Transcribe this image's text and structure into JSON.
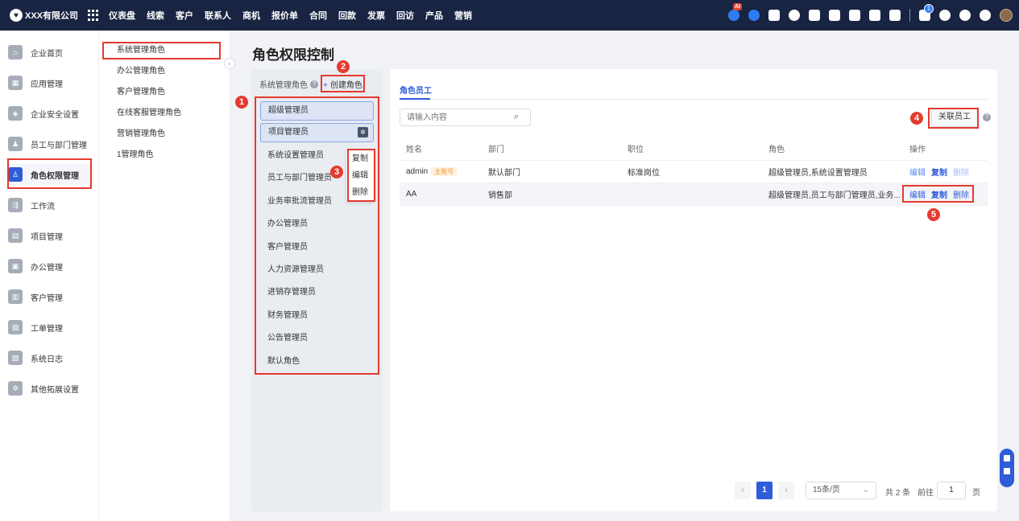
{
  "topbar": {
    "company": "XXX有限公司",
    "nav": [
      "仪表盘",
      "线索",
      "客户",
      "联系人",
      "商机",
      "报价单",
      "合同",
      "回款",
      "发票",
      "回访",
      "产品",
      "营销"
    ],
    "ai_badge": "AI",
    "notification_count": "1"
  },
  "sidebar": {
    "items": [
      "企业首页",
      "应用管理",
      "企业安全设置",
      "员工与部门管理",
      "角色权限管理",
      "工作流",
      "项目管理",
      "办公管理",
      "客户管理",
      "工单管理",
      "系统日志",
      "其他拓展设置"
    ]
  },
  "submenu": {
    "items": [
      "系统管理角色",
      "办公管理角色",
      "客户管理角色",
      "在线客服管理角色",
      "营销管理角色",
      "1管理角色"
    ]
  },
  "page": {
    "title": "角色权限控制"
  },
  "roles": {
    "header": "系统管理角色",
    "create_label": "创建角色",
    "list": [
      "超级管理员",
      "项目管理员",
      "系统设置管理员",
      "员工与部门管理员",
      "业务审批流管理员",
      "办公管理员",
      "客户管理员",
      "人力资源管理员",
      "进销存管理员",
      "财务管理员",
      "公告管理员",
      "默认角色"
    ]
  },
  "context_menu": {
    "copy": "复制",
    "edit": "编辑",
    "delete": "删除"
  },
  "content": {
    "tab": "角色员工",
    "search_placeholder": "请输入内容",
    "assoc_button": "关联员工",
    "columns": [
      "姓名",
      "部门",
      "职位",
      "角色",
      "操作"
    ],
    "rows": [
      {
        "name": "admin",
        "tag": "主账号",
        "dept": "默认部门",
        "position": "标准岗位",
        "roles": "超级管理员,系统设置管理员"
      },
      {
        "name": "AA",
        "tag": "",
        "dept": "销售部",
        "position": "",
        "roles": "超级管理员,员工与部门管理员,业务..."
      }
    ],
    "ops": {
      "edit": "编辑",
      "copy": "复制",
      "delete": "删除"
    }
  },
  "pagination": {
    "current": "1",
    "page_size": "15条/页",
    "total": "共 2 条",
    "goto_label": "前往",
    "goto_value": "1",
    "unit": "页"
  },
  "annotations": [
    "1",
    "2",
    "3",
    "4",
    "5"
  ],
  "colors": {
    "topbar": "#182442",
    "primary": "#2f5cd8",
    "annotation": "#e53a2e"
  }
}
